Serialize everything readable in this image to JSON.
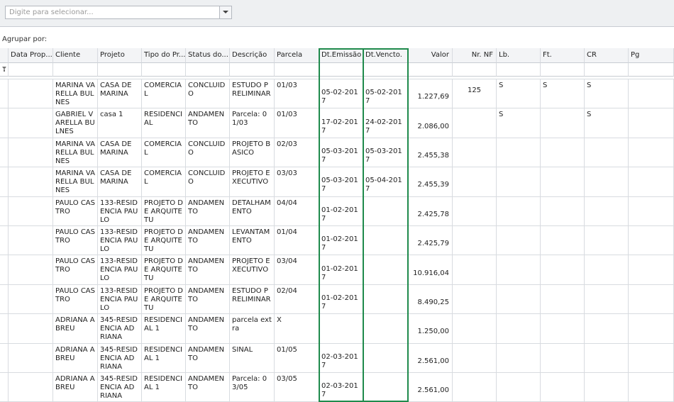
{
  "selector": {
    "placeholder": "Digite para selecionar..."
  },
  "group_by_label": "Agrupar por:",
  "columns": [
    {
      "key": "data_prop",
      "label": "Data Prop..."
    },
    {
      "key": "cliente",
      "label": "Cliente"
    },
    {
      "key": "projeto",
      "label": "Projeto"
    },
    {
      "key": "tipo",
      "label": "Tipo do Pr..."
    },
    {
      "key": "status",
      "label": "Status do..."
    },
    {
      "key": "descricao",
      "label": "Descrição"
    },
    {
      "key": "parcela",
      "label": "Parcela"
    },
    {
      "key": "dt_emissao",
      "label": "Dt.Emissão"
    },
    {
      "key": "dt_vencto",
      "label": "Dt.Vencto."
    },
    {
      "key": "valor",
      "label": "Valor"
    },
    {
      "key": "nr_nf",
      "label": "Nr. NF"
    },
    {
      "key": "lb",
      "label": "Lb."
    },
    {
      "key": "ft",
      "label": "Ft."
    },
    {
      "key": "cr",
      "label": "CR"
    },
    {
      "key": "pg",
      "label": "Pg"
    }
  ],
  "rows": [
    {
      "data_prop": "",
      "cliente": "MARINA VARELLA BULNES",
      "projeto": "CASA DE MARINA",
      "tipo": "COMERCIAL",
      "status": "CONCLUIDO",
      "descricao": "ESTUDO PRELIMINAR",
      "parcela": "01/03",
      "dt_emissao": "05-02-2017",
      "dt_vencto": "05-02-2017",
      "valor": "1.227,69",
      "nr_nf": "125",
      "lb": "S",
      "ft": "S",
      "cr": "S",
      "pg": ""
    },
    {
      "data_prop": "",
      "cliente": "GABRIEL VARELLA BULNES",
      "projeto": "casa 1",
      "tipo": "RESIDENCIAL",
      "status": "ANDAMENTO",
      "descricao": "Parcela: 01/03",
      "parcela": "01/03",
      "dt_emissao": "17-02-2017",
      "dt_vencto": "24-02-2017",
      "valor": "2.086,00",
      "nr_nf": "",
      "lb": "S",
      "ft": "",
      "cr": "S",
      "pg": ""
    },
    {
      "data_prop": "",
      "cliente": "MARINA VARELLA BULNES",
      "projeto": "CASA DE MARINA",
      "tipo": "COMERCIAL",
      "status": "CONCLUIDO",
      "descricao": "PROJETO BASICO",
      "parcela": "02/03",
      "dt_emissao": "05-03-2017",
      "dt_vencto": "05-03-2017",
      "valor": "2.455,38",
      "nr_nf": "",
      "lb": "",
      "ft": "",
      "cr": "",
      "pg": ""
    },
    {
      "data_prop": "",
      "cliente": "MARINA VARELLA BULNES",
      "projeto": "CASA DE MARINA",
      "tipo": "COMERCIAL",
      "status": "CONCLUIDO",
      "descricao": "PROJETO EXECUTIVO",
      "parcela": "03/03",
      "dt_emissao": "05-03-2017",
      "dt_vencto": "05-04-2017",
      "valor": "2.455,39",
      "nr_nf": "",
      "lb": "",
      "ft": "",
      "cr": "",
      "pg": ""
    },
    {
      "data_prop": "",
      "cliente": "PAULO CASTRO",
      "projeto": "133-RESIDENCIA PAULO",
      "tipo": "PROJETO DE ARQUITETU",
      "status": "ANDAMENTO",
      "descricao": "DETALHAMENTO",
      "parcela": "04/04",
      "dt_emissao": "01-02-2017",
      "dt_vencto": "",
      "valor": "2.425,78",
      "nr_nf": "",
      "lb": "",
      "ft": "",
      "cr": "",
      "pg": ""
    },
    {
      "data_prop": "",
      "cliente": "PAULO CASTRO",
      "projeto": "133-RESIDENCIA PAULO",
      "tipo": "PROJETO DE ARQUITETU",
      "status": "ANDAMENTO",
      "descricao": "LEVANTAMENTO",
      "parcela": "01/04",
      "dt_emissao": "01-02-2017",
      "dt_vencto": "",
      "valor": "2.425,79",
      "nr_nf": "",
      "lb": "",
      "ft": "",
      "cr": "",
      "pg": ""
    },
    {
      "data_prop": "",
      "cliente": "PAULO CASTRO",
      "projeto": "133-RESIDENCIA PAULO",
      "tipo": "PROJETO DE ARQUITETU",
      "status": "ANDAMENTO",
      "descricao": "PROJETO EXECUTIVO",
      "parcela": "03/04",
      "dt_emissao": "01-02-2017",
      "dt_vencto": "",
      "valor": "10.916,04",
      "nr_nf": "",
      "lb": "",
      "ft": "",
      "cr": "",
      "pg": ""
    },
    {
      "data_prop": "",
      "cliente": "PAULO CASTRO",
      "projeto": "133-RESIDENCIA PAULO",
      "tipo": "PROJETO DE ARQUITETU",
      "status": "ANDAMENTO",
      "descricao": "ESTUDO PRELIMINAR",
      "parcela": "02/04",
      "dt_emissao": "01-02-2017",
      "dt_vencto": "",
      "valor": "8.490,25",
      "nr_nf": "",
      "lb": "",
      "ft": "",
      "cr": "",
      "pg": ""
    },
    {
      "data_prop": "",
      "cliente": "ADRIANA ABREU",
      "projeto": "345-RESIDENCIA ADRIANA",
      "tipo": "RESIDENCIAL 1",
      "status": "ANDAMENTO",
      "descricao": "parcela extra",
      "parcela": "X",
      "dt_emissao": "",
      "dt_vencto": "",
      "valor": "1.250,00",
      "nr_nf": "",
      "lb": "",
      "ft": "",
      "cr": "",
      "pg": ""
    },
    {
      "data_prop": "",
      "cliente": "ADRIANA ABREU",
      "projeto": "345-RESIDENCIA ADRIANA",
      "tipo": "RESIDENCIAL 1",
      "status": "ANDAMENTO",
      "descricao": "SINAL",
      "parcela": "01/05",
      "dt_emissao": "02-03-2017",
      "dt_vencto": "",
      "valor": "2.561,00",
      "nr_nf": "",
      "lb": "",
      "ft": "",
      "cr": "",
      "pg": ""
    },
    {
      "data_prop": "",
      "cliente": "ADRIANA ABREU",
      "projeto": "345-RESIDENCIA ADRIANA",
      "tipo": "RESIDENCIAL 1",
      "status": "ANDAMENTO",
      "descricao": "Parcela: 03/05",
      "parcela": "03/05",
      "dt_emissao": "02-03-2017",
      "dt_vencto": "",
      "valor": "2.561,00",
      "nr_nf": "",
      "lb": "",
      "ft": "",
      "cr": "",
      "pg": ""
    }
  ],
  "colors": {
    "highlight": "#1f8a4c",
    "header_bg": "#f3f4f6",
    "grid_line": "#d8dbe0"
  }
}
